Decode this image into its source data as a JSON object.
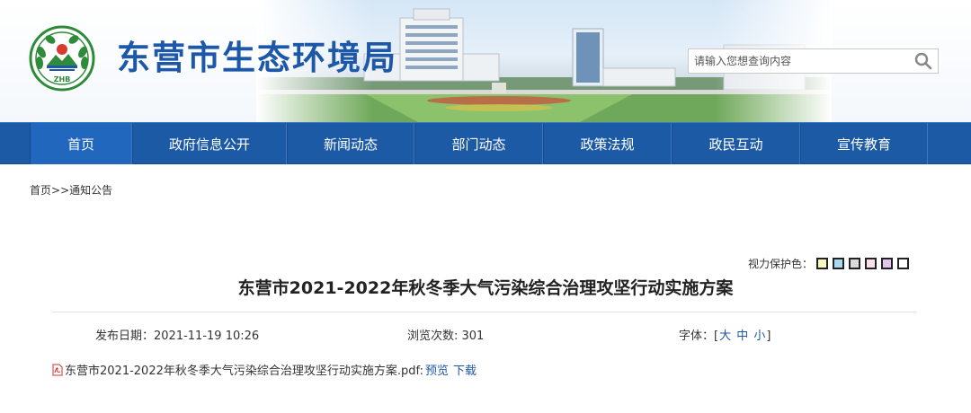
{
  "header": {
    "site_title": "东营市生态环境局",
    "logo_text": "ZHB",
    "search_placeholder": "请输入您想查询内容"
  },
  "nav": {
    "items": [
      "首页",
      "政府信息公开",
      "新闻动态",
      "部门动态",
      "政策法规",
      "政民互动",
      "宣传教育"
    ],
    "active_index": 0
  },
  "breadcrumb": {
    "home": "首页",
    "separator": ">>",
    "current": "通知公告"
  },
  "eye_care": {
    "label": "视力保护色：",
    "colors": [
      "#fafabe",
      "#a9d9f3",
      "#dadada",
      "#fde1e9",
      "#e3c6ee",
      "#ffffff"
    ]
  },
  "article": {
    "title": "东营市2021-2022年秋冬季大气污染综合治理攻坚行动实施方案",
    "publish_label": "发布日期：",
    "publish_date": "2021-11-19 10:26",
    "views_label": "浏览次数: ",
    "views": "301",
    "font_label": "字体：[",
    "font_large": "大",
    "font_medium": "中",
    "font_small": "小",
    "font_close": "]"
  },
  "attachment": {
    "filename": "东营市2021-2022年秋冬季大气污染综合治理攻坚行动实施方案.pdf:",
    "preview": "预览",
    "download": "下载"
  },
  "colors": {
    "brand_blue": "#1d57a8",
    "nav_bg": "#1d5aa6",
    "nav_active": "#2067bd"
  }
}
